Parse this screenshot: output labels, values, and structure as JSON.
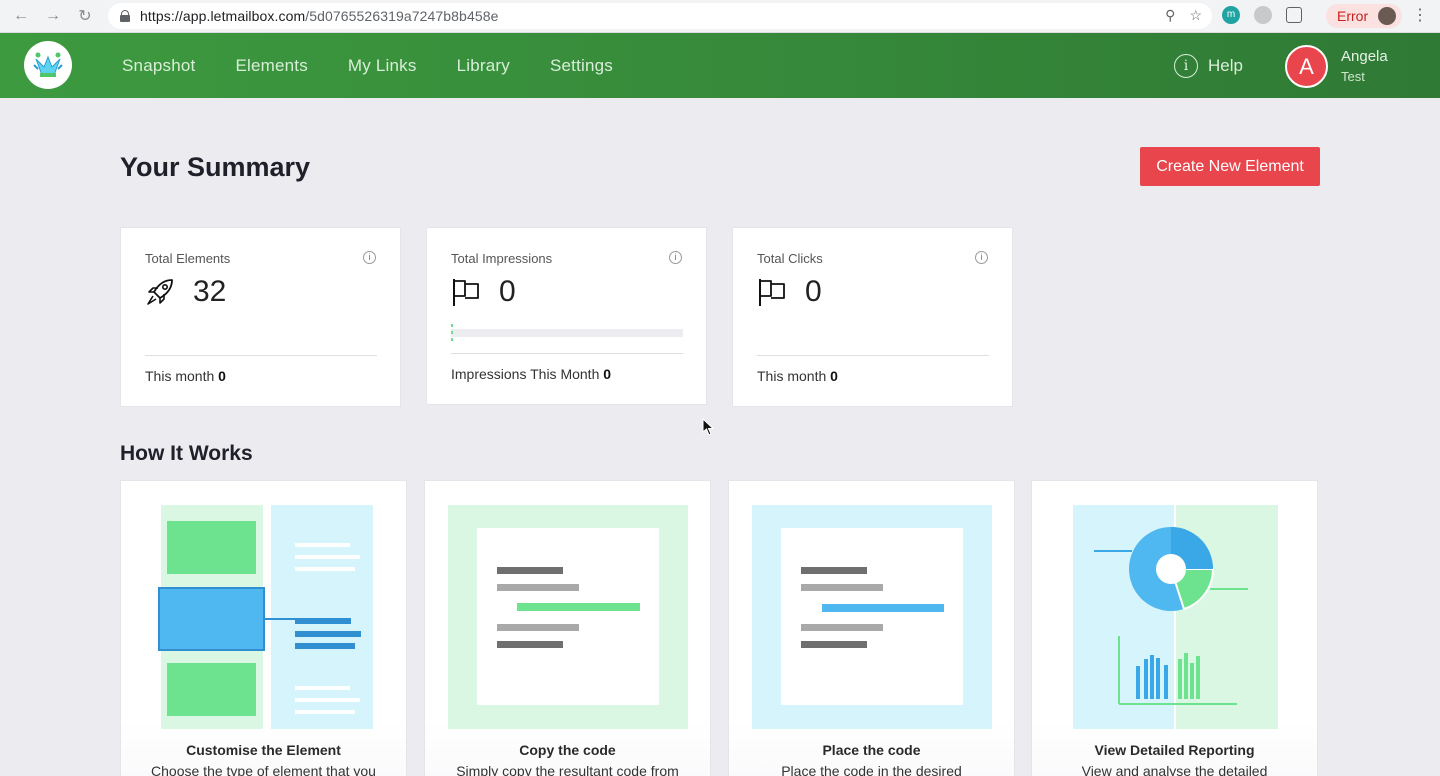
{
  "browser": {
    "url_host": "https://app.letmailbox.com",
    "url_path": "/5d0765526319a7247b8b458e",
    "error_label": "Error"
  },
  "appbar": {
    "nav": [
      "Snapshot",
      "Elements",
      "My Links",
      "Library",
      "Settings"
    ],
    "help_label": "Help",
    "user_initial": "A",
    "user_name": "Angela",
    "user_sub": "Test"
  },
  "summary": {
    "title": "Your Summary",
    "create_button": "Create New Element",
    "stats": [
      {
        "label": "Total Elements",
        "value": "32",
        "icon": "rocket-icon",
        "footer_label": "This month",
        "footer_value": "0"
      },
      {
        "label": "Total Impressions",
        "value": "0",
        "icon": "flag-icon",
        "progress": 0,
        "footer_label": "Impressions This Month",
        "footer_value": "0"
      },
      {
        "label": "Total Clicks",
        "value": "0",
        "icon": "flag-icon",
        "footer_label": "This month",
        "footer_value": "0"
      }
    ]
  },
  "how_it_works": {
    "title": "How It Works",
    "steps": [
      {
        "title": "Customise the Element",
        "desc": "Choose the type of element that you"
      },
      {
        "title": "Copy the code",
        "desc": "Simply copy the resultant code from"
      },
      {
        "title": "Place the code",
        "desc": "Place the code in the desired"
      },
      {
        "title": "View Detailed Reporting",
        "desc": "View and analyse the detailed"
      }
    ]
  },
  "colors": {
    "brand_green": "#3d9a3f",
    "accent_red": "#e8454c",
    "illus_green": "#6ee38f",
    "illus_blue": "#4fb8f0"
  }
}
